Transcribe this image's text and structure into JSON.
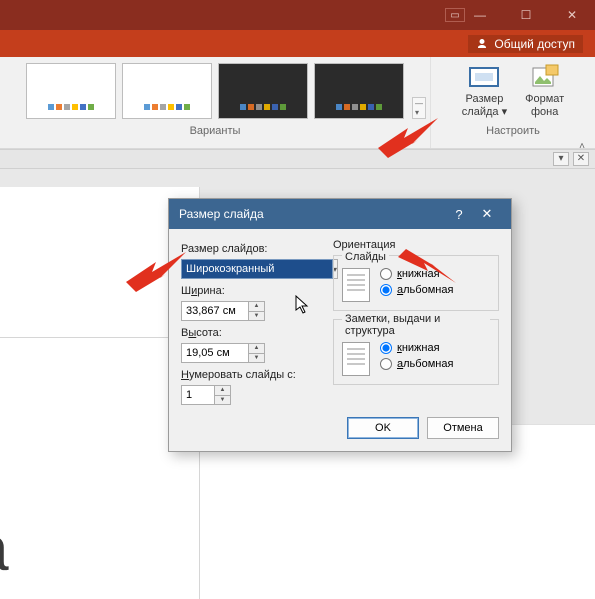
{
  "titlebar": {
    "share_label": "Общий доступ"
  },
  "ribbon": {
    "variants_label": "Варианты",
    "configure_label": "Настроить",
    "slide_size_label": "Размер\nслайда",
    "slide_size_caret": "▾",
    "bg_format_label": "Формат\nфона"
  },
  "dialog": {
    "title": "Размер слайда",
    "size_label": "Размер слайдов:",
    "size_value": "Широкоэкранный",
    "width_label_pre": "Ш",
    "width_label_ul": "и",
    "width_label_post": "рина:",
    "width_value": "33,867 см",
    "height_label_pre": "В",
    "height_label_ul": "ы",
    "height_label_post": "сота:",
    "height_value": "19,05 см",
    "numbering_label_pre": "",
    "numbering_label_ul": "Н",
    "numbering_label_post": "умеровать слайды с:",
    "numbering_value": "1",
    "orientation_title": "Ориентация",
    "slides_legend": "Слайды",
    "notes_legend": "Заметки, выдачи и структура",
    "portrait_ul": "к",
    "portrait_rest": "нижная",
    "landscape_ul": "а",
    "landscape_rest": "льбомная",
    "ok": "OK",
    "cancel": "Отмена"
  },
  "slide": {
    "bigtext": "да"
  },
  "colors": {
    "bars_light": [
      "#5b9bd5",
      "#ed7d31",
      "#a5a5a5",
      "#ffc000",
      "#4472c4",
      "#70ad47"
    ],
    "bars_dark": [
      "#4a86c5",
      "#d66a24",
      "#8f8f8f",
      "#e0aa00",
      "#3a62b0",
      "#5e9a3a"
    ]
  }
}
